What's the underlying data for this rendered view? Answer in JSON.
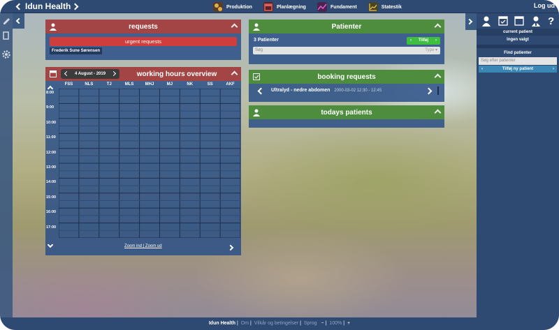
{
  "app": {
    "title": "Idun Health",
    "logout": "Log ud"
  },
  "nav": [
    {
      "label": "Produktion",
      "icon": "gears-icon",
      "color": "#e0b050"
    },
    {
      "label": "Planlægning",
      "icon": "calendar-icon",
      "color": "#c43b3b"
    },
    {
      "label": "Fundament",
      "icon": "trend-icon",
      "color": "#b23aa2"
    },
    {
      "label": "Statestik",
      "icon": "chart-icon",
      "color": "#d0b040"
    }
  ],
  "requests": {
    "title": "requests",
    "urgent": "urgent requests",
    "user": "Frederik Sune Sørensen"
  },
  "calendar": {
    "title": "working hours overview",
    "date": "4 August - 2019",
    "columns": [
      "FSS",
      "NLS",
      "TJ",
      "MLS",
      "MHJ",
      "MJ",
      "NK",
      "SS",
      "AKF"
    ],
    "rows": [
      "8:00",
      "9:00",
      "10:00",
      "11:00",
      "12:00",
      "13:00",
      "14:00",
      "15:00",
      "16:00",
      "17:00"
    ],
    "zoom_in": "Zoom ind",
    "zoom_sep": "|",
    "zoom_out": "Zoom ud"
  },
  "patients": {
    "title": "Patienter",
    "count": "3 Patienter",
    "add": "Tilføj",
    "search_placeholder": "Søg",
    "type_label": "Type"
  },
  "booking": {
    "title": "booking requests",
    "item": "Ultralyd - nedre abdomen",
    "time": "2000-03-02 12:30 - 12:45"
  },
  "today": {
    "title": "todays patients"
  },
  "sidebar": {
    "current_title": "current patient",
    "current_value": "Ingen valgt",
    "find_title": "Find patienter",
    "find_placeholder": "Søg efter patienter",
    "add_new": "Tilføj ny patient"
  },
  "footer": {
    "brand": "Idun Health",
    "about": "Om",
    "terms": "Vilkår og betingelser",
    "lang": "Sprog",
    "minus": "−",
    "zoom": "100%",
    "plus": "+"
  }
}
